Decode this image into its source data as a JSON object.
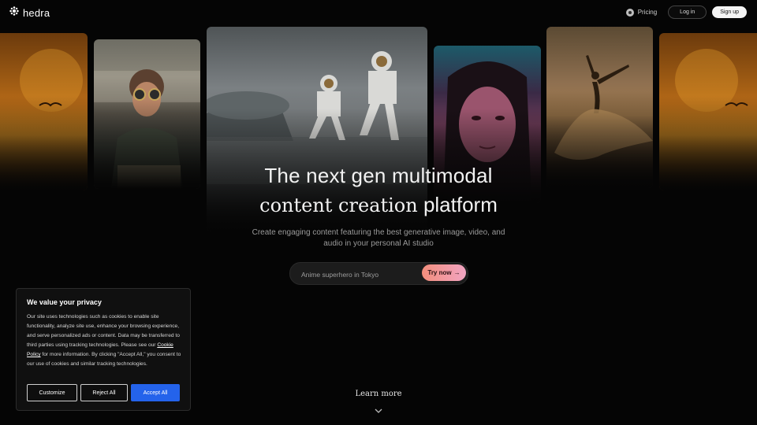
{
  "header": {
    "logo_text": "hedra",
    "pricing_label": "Pricing",
    "login_label": "Log in",
    "signup_label": "Sign up"
  },
  "hero": {
    "title_line1": "The next gen multimodal",
    "title_line2_serif": "content creation",
    "title_line2_sans": "platform",
    "subtitle_line1": "Create engaging content featuring the best generative image, video, and",
    "subtitle_line2": "audio in your personal AI studio",
    "prompt_value": "Anime superhero in Tokyo",
    "try_label": "Try now",
    "try_arrow": "→",
    "learn_more": "Learn more"
  },
  "cookie": {
    "title": "We value your privacy",
    "body_before_link": "Our site uses technologies such as cookies to enable site functionality, analyze site use, enhance your browsing experience, and serve personalized ads or content. Data may be transferred to third parties using tracking technologies. Please see our ",
    "link_text": "Cookie Policy",
    "body_after_link": " for more information. By clicking \"Accept All,\" you consent to our use of cookies and similar tracking technologies.",
    "customize_label": "Customize",
    "reject_label": "Reject All",
    "accept_label": "Accept All"
  },
  "colors": {
    "background": "#050505",
    "accept_button": "#2463eb",
    "try_button_gradient": [
      "#f38e7c",
      "#f1a4c2"
    ]
  },
  "icons": {
    "logo": "hedra-logo-icon",
    "pricing": "pricing-icon",
    "learn_more": "chevron-down-icon"
  }
}
